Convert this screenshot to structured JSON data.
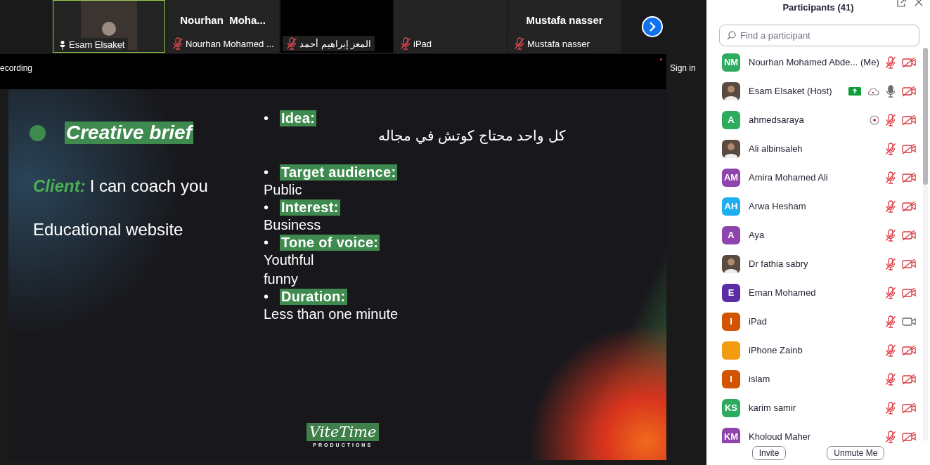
{
  "tiles": [
    {
      "kind": "photo",
      "label": "Esam Elsaket",
      "pinned": true,
      "muted": false,
      "highlighted": true
    },
    {
      "kind": "name",
      "display": "Nourhan  Moha...",
      "label": "Nourhan Mohamed ...",
      "pinned": false,
      "muted": true,
      "highlighted": false
    },
    {
      "kind": "black",
      "label": "المعز إبراهيم أحمد",
      "pinned": false,
      "muted": true,
      "highlighted": false
    },
    {
      "kind": "dark",
      "label": "iPad",
      "pinned": false,
      "muted": true,
      "highlighted": false
    },
    {
      "kind": "name",
      "display": "Mustafa nasser",
      "label": "Mustafa nasser",
      "pinned": false,
      "muted": true,
      "highlighted": false
    }
  ],
  "meeting_bar": {
    "recording_text": "ecording",
    "sign_in": "Sign in"
  },
  "slide": {
    "title": "Creative brief",
    "client_label": "Client:",
    "client_name": "I can coach you",
    "subtitle": "Educational website",
    "bullets": [
      {
        "marker": "•",
        "heading": "Idea:",
        "values": [
          "كل واحد محتاج كوتش في مجاله"
        ]
      },
      {
        "marker": "•",
        "heading": "Target audience:",
        "values": [
          "Public"
        ]
      },
      {
        "marker": "•",
        "heading": "Interest:",
        "values": [
          "Business"
        ]
      },
      {
        "marker": "•",
        "heading": "Tone of voice:",
        "values": [
          "Youthful",
          "funny"
        ]
      },
      {
        "marker": "•",
        "heading": "Duration:",
        "values": [
          "Less than one minute"
        ]
      }
    ],
    "logo": {
      "name": "ViteTime",
      "tagline": "PRODUCTIONS"
    }
  },
  "panel": {
    "title": "Participants (41)",
    "search": {
      "placeholder": "Find a participant"
    },
    "participants": [
      {
        "kind": "initials",
        "initials": "NM",
        "color": "#2dab5f",
        "name": "Nourhan Mohamed Abde... (Me)",
        "muted": true,
        "video_on": false
      },
      {
        "kind": "photo",
        "name": "Esam Elsaket (Host)",
        "status": [
          {
            "kind": "share"
          },
          {
            "kind": "cloud"
          }
        ],
        "muted": false,
        "video_on": false
      },
      {
        "kind": "initials",
        "initials": "A",
        "color": "#2dab5f",
        "name": "ahmedsaraya",
        "status": [
          {
            "kind": "record"
          }
        ],
        "muted": true,
        "video_on": false
      },
      {
        "kind": "photo",
        "name": "Ali albinsaleh",
        "muted": true,
        "video_on": false
      },
      {
        "kind": "initials",
        "initials": "AM",
        "color": "#8e44ad",
        "name": "Amira Mohamed Ali",
        "muted": true,
        "video_on": false
      },
      {
        "kind": "initials",
        "initials": "AH",
        "color": "#1eaef0",
        "name": "Arwa Hesham",
        "muted": true,
        "video_on": false
      },
      {
        "kind": "initials",
        "initials": "A",
        "color": "#8e44ad",
        "name": "Aya",
        "muted": true,
        "video_on": false
      },
      {
        "kind": "photo",
        "name": "Dr fathia sabry",
        "muted": true,
        "video_on": false
      },
      {
        "kind": "initials",
        "initials": "E",
        "color": "#5a2da5",
        "name": "Eman Mohamed",
        "muted": true,
        "video_on": false
      },
      {
        "kind": "initials",
        "initials": "I",
        "color": "#d35400",
        "name": "iPad",
        "muted": true,
        "video_on": true
      },
      {
        "kind": "initials",
        "color": "#f39c12",
        "name": "iPhone Zainb",
        "muted": true,
        "video_on": false
      },
      {
        "kind": "initials",
        "initials": "I",
        "color": "#d35400",
        "name": "islam",
        "muted": true,
        "video_on": false
      },
      {
        "kind": "initials",
        "initials": "KS",
        "color": "#2dab5f",
        "name": "karim samir",
        "muted": true,
        "video_on": false
      },
      {
        "kind": "initials",
        "initials": "KM",
        "color": "#8e44ad",
        "name": "Kholoud Maher",
        "muted": true,
        "video_on": false
      }
    ],
    "buttons": [
      "Invite",
      "Unmute Me"
    ]
  }
}
